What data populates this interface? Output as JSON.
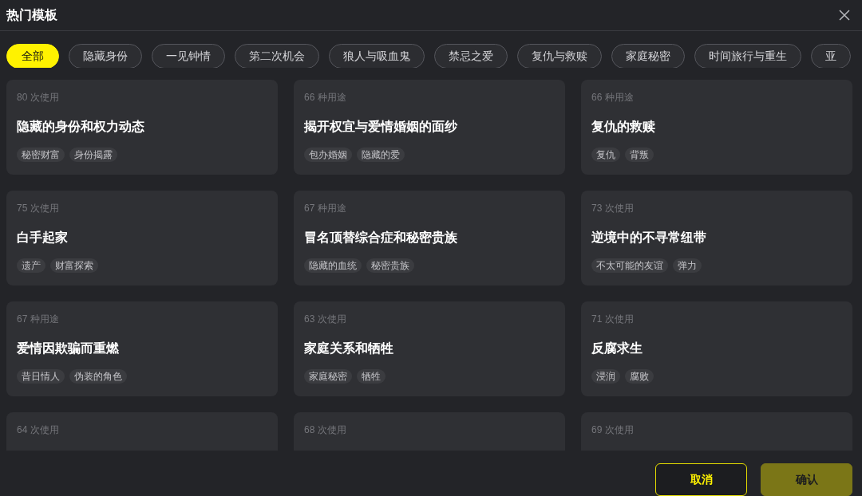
{
  "dialog": {
    "title": "热门模板"
  },
  "categories": [
    {
      "label": "全部",
      "selected": true
    },
    {
      "label": "隐藏身份",
      "selected": false
    },
    {
      "label": "一见钟情",
      "selected": false
    },
    {
      "label": "第二次机会",
      "selected": false
    },
    {
      "label": "狼人与吸血鬼",
      "selected": false
    },
    {
      "label": "禁忌之爱",
      "selected": false
    },
    {
      "label": "复仇与救赎",
      "selected": false
    },
    {
      "label": "家庭秘密",
      "selected": false
    },
    {
      "label": "时间旅行与重生",
      "selected": false
    },
    {
      "label": "亚",
      "selected": false
    }
  ],
  "templates": [
    {
      "usage": "80 次使用",
      "title": "隐藏的身份和权力动态",
      "tags": [
        "秘密财富",
        "身份揭露"
      ]
    },
    {
      "usage": "66 种用途",
      "title": "揭开权宜与爱情婚姻的面纱",
      "tags": [
        "包办婚姻",
        "隐藏的爱"
      ]
    },
    {
      "usage": "66 种用途",
      "title": "复仇的救赎",
      "tags": [
        "复仇",
        "背叛"
      ]
    },
    {
      "usage": "75 次使用",
      "title": "白手起家",
      "tags": [
        "遗产",
        "财富探索"
      ]
    },
    {
      "usage": "67 种用途",
      "title": "冒名顶替综合症和秘密贵族",
      "tags": [
        "隐藏的血统",
        "秘密贵族"
      ]
    },
    {
      "usage": "73 次使用",
      "title": "逆境中的不寻常纽带",
      "tags": [
        "不太可能的友谊",
        "弹力"
      ]
    },
    {
      "usage": "67 种用途",
      "title": "爱情因欺骗而重燃",
      "tags": [
        "昔日情人",
        "伪装的角色"
      ]
    },
    {
      "usage": "63 次使用",
      "title": "家庭关系和牺牲",
      "tags": [
        "家庭秘密",
        "牺牲"
      ]
    },
    {
      "usage": "71 次使用",
      "title": "反腐求生",
      "tags": [
        "浸润",
        "腐败"
      ]
    },
    {
      "usage": "64 次使用"
    },
    {
      "usage": "68 次使用"
    },
    {
      "usage": "69 次使用"
    }
  ],
  "buttons": [
    {
      "kind": "cancel",
      "label": "取消",
      "disabled": false
    },
    {
      "kind": "confirm",
      "label": "确认",
      "disabled": true
    }
  ]
}
